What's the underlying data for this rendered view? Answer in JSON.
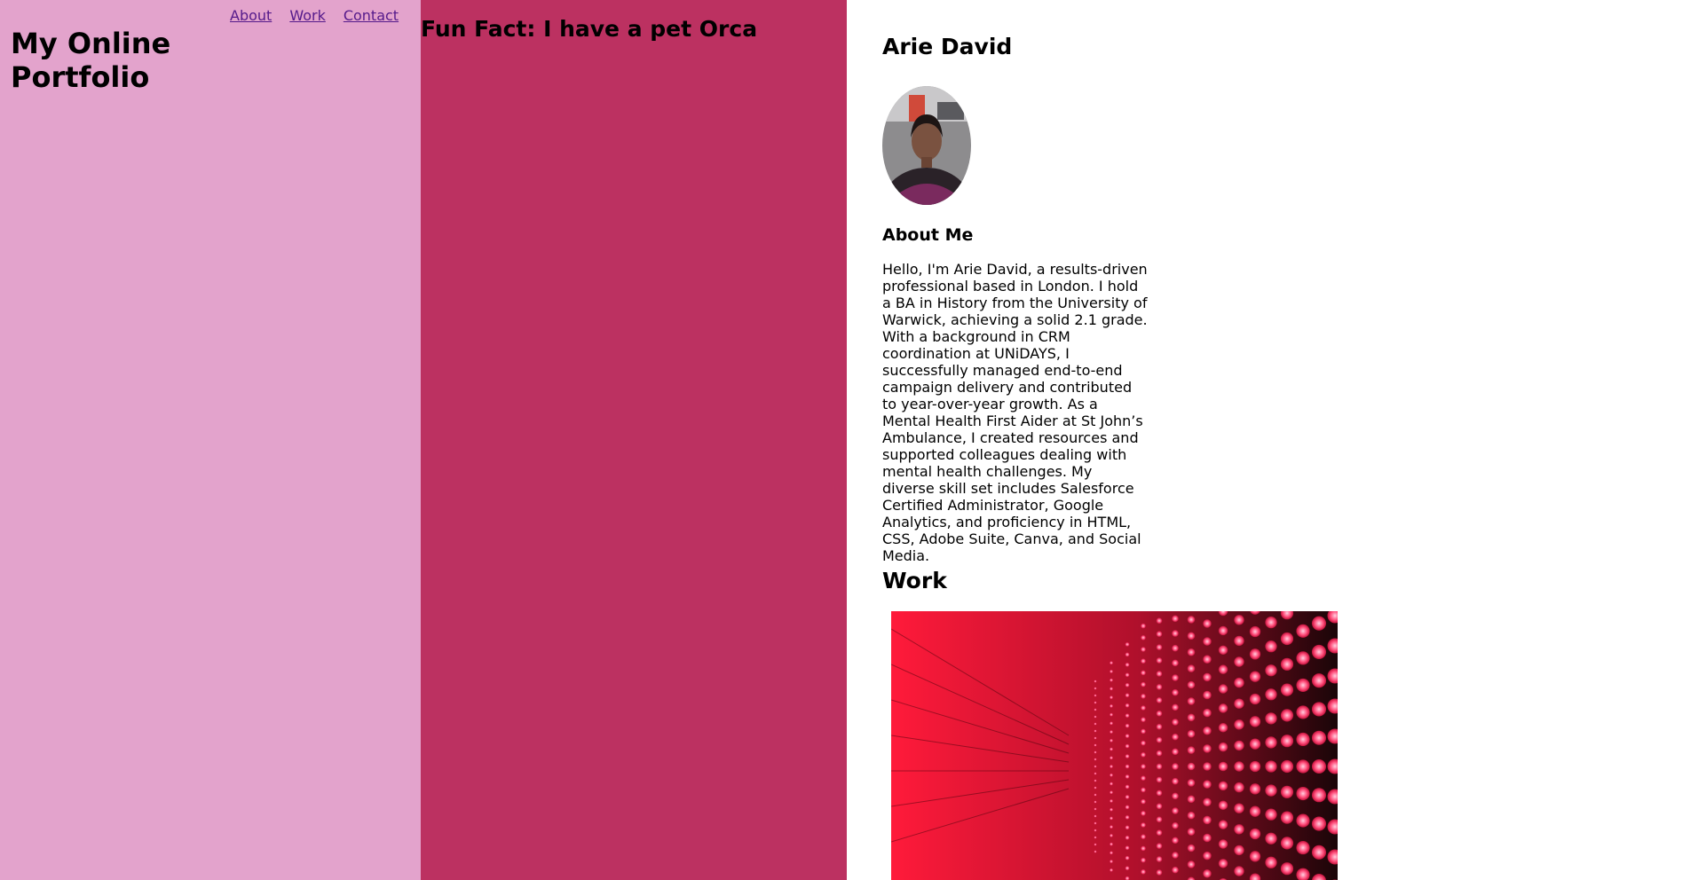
{
  "nav": {
    "items": [
      {
        "label": "About"
      },
      {
        "label": "Work"
      },
      {
        "label": "Contact"
      }
    ]
  },
  "site_title": "My Online Portfolio",
  "fun_fact": "Fun Fact: I have a pet Orca",
  "profile": {
    "name": "Arie David",
    "avatar_icon": "profile-photo"
  },
  "about": {
    "heading": "About Me",
    "text": "Hello, I'm Arie David, a results-driven professional based in London. I hold a BA in History from the University of Warwick, achieving a solid 2.1 grade. With a background in CRM coordination at UNiDAYS, I successfully managed end-to-end campaign delivery and contributed to year-over-year growth. As a Mental Health First Aider at St John’s Ambulance, I created resources and supported colleagues dealing with mental health challenges. My diverse skill set includes Salesforce Certified Administrator, Google Analytics, and proficiency in HTML, CSS, Adobe Suite, Canva, and Social Media."
  },
  "work": {
    "heading": "Work",
    "image_icon": "red-led-wall-image"
  },
  "colors": {
    "left_column": "#e3a3cc",
    "middle_column": "#bc3161",
    "right_column": "#ffffff",
    "link": "#551a8b"
  }
}
